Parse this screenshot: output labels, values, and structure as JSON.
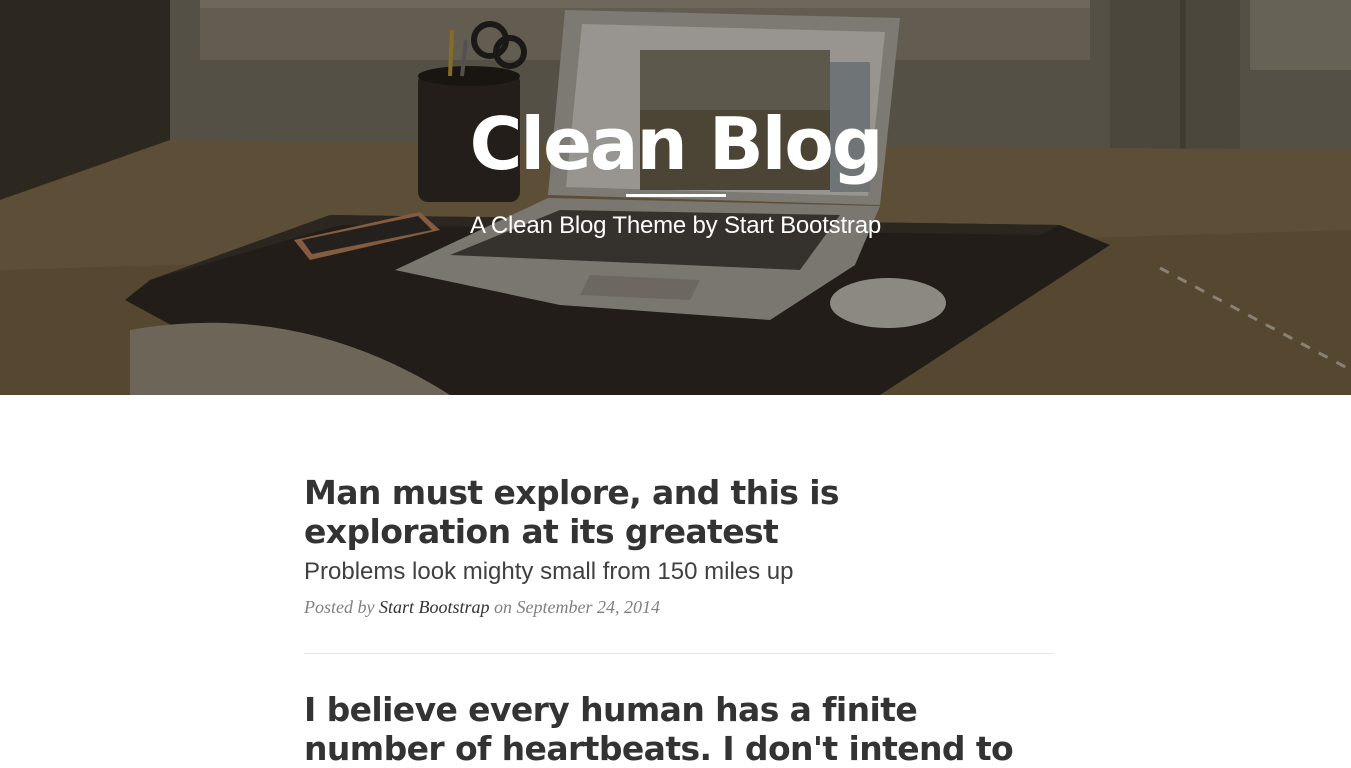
{
  "header": {
    "title": "Clean Blog",
    "subheading": "A Clean Blog Theme by Start Bootstrap"
  },
  "posts": [
    {
      "title": "Man must explore, and this is exploration at its greatest",
      "subtitle": "Problems look mighty small from 150 miles up",
      "meta_prefix": "Posted by",
      "author": "Start Bootstrap",
      "meta_on": "on",
      "date": "September 24, 2014"
    },
    {
      "title": "I believe every human has a finite number of heartbeats. I don't intend to"
    }
  ],
  "colors": {
    "heading_text": "#333333",
    "meta_text": "#808080",
    "divider": "#e6e6e6",
    "hero_text": "#ffffff"
  }
}
